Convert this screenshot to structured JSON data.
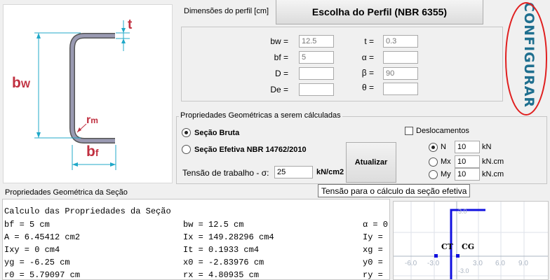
{
  "drawing": {
    "label_t": "t",
    "label_bw": "b",
    "label_bw_sub": "W",
    "label_rm": "r",
    "label_rm_sub": "m",
    "label_bf": "b",
    "label_bf_sub": "f"
  },
  "dimensions": {
    "title": "Dimensões do perfil [cm]",
    "choose_button": "Escolha do Perfil (NBR 6355)",
    "fields": {
      "bw": {
        "label": "bw =",
        "value": "12.5"
      },
      "bf": {
        "label": "bf =",
        "value": "5"
      },
      "D": {
        "label": "D =",
        "value": ""
      },
      "De": {
        "label": "De =",
        "value": ""
      },
      "t": {
        "label": "t =",
        "value": "0.3"
      },
      "alpha": {
        "label": "α =",
        "value": ""
      },
      "beta": {
        "label": "β =",
        "value": "90"
      },
      "theta": {
        "label": "θ =",
        "value": ""
      }
    }
  },
  "configurar": {
    "label": "CONFIGURAR",
    "color": "#1f6f8f",
    "annotation_color": "#e02020"
  },
  "properties": {
    "legend": "Propriedades Geométricas a serem cálculadas",
    "option_gross": "Seção Bruta",
    "option_effective": "Seção Efetiva NBR 14762/2010",
    "selected": "gross",
    "stress_label": "Tensão de trabalho - σ:",
    "stress_value": "25",
    "stress_unit": "kN/cm2",
    "update_button": "Atualizar",
    "tooltip": "Tensão para o cálculo da seção efetiva",
    "displacements": {
      "label": "Deslocamentos",
      "checked": false,
      "loads": [
        {
          "label": "N",
          "value": "10",
          "unit": "kN",
          "selected": true
        },
        {
          "label": "Mx",
          "value": "10",
          "unit": "kN.cm",
          "selected": false
        },
        {
          "label": "My",
          "value": "10",
          "unit": "kN.cm",
          "selected": false
        }
      ]
    }
  },
  "results": {
    "label": "Propriedades Geométrica da Seção",
    "lines": [
      [
        "Calculo das Propriedades da Seção",
        "",
        ""
      ],
      [
        "bf = 5 cm",
        "bw = 12.5 cm",
        "α = 0"
      ],
      [
        "A = 6.45412 cm2",
        "Ix = 149.28296 cm4",
        "Iy ="
      ],
      [
        "Ixy = 0 cm4",
        "It = 0.1933 cm4",
        "xg ="
      ],
      [
        "yg = -6.25 cm",
        "x0 = -2.83976 cm",
        "y0 ="
      ],
      [
        "r0 = 5.79097 cm",
        "rx = 4.80935 cm",
        "ry ="
      ]
    ]
  },
  "plot": {
    "ticks_x": [
      "-6.0",
      "-3.0",
      "3.0",
      "6.0",
      "9.0"
    ],
    "ticks_y": [
      "3.0",
      "-3.0",
      "-6.0"
    ],
    "label_ct": "CT",
    "label_cg": "CG",
    "section_color": "#1010e0"
  }
}
